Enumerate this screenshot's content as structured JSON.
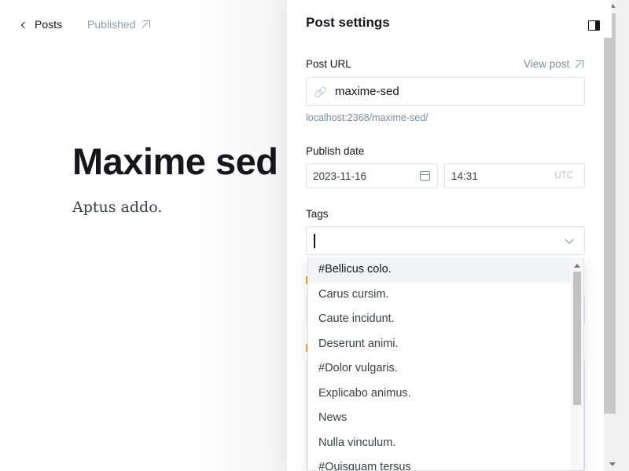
{
  "nav": {
    "back_label": "Posts",
    "status_label": "Published"
  },
  "post": {
    "title": "Maxime sed",
    "body": "Aptus addo."
  },
  "settings": {
    "title": "Post settings",
    "url_label": "Post URL",
    "view_post": "View post",
    "url_value": "maxime-sed",
    "url_hint": "localhost:2368/maxime-sed/",
    "publish_label": "Publish date",
    "date_value": "2023-11-16",
    "time_value": "14:31",
    "timezone": "UTC",
    "tags_label": "Tags",
    "tags_value": ""
  },
  "tag_options": [
    "#Bellicus colo.",
    "Carus cursim.",
    "Caute incidunt.",
    "Deserunt animi.",
    "#Dolor vulgaris.",
    "Explicabo animus.",
    "News",
    "Nulla vinculum.",
    "#Quisquam tersus"
  ],
  "colors": {
    "accent": "#f3a63a",
    "text": "#15171a",
    "muted": "#7c8b9a"
  }
}
